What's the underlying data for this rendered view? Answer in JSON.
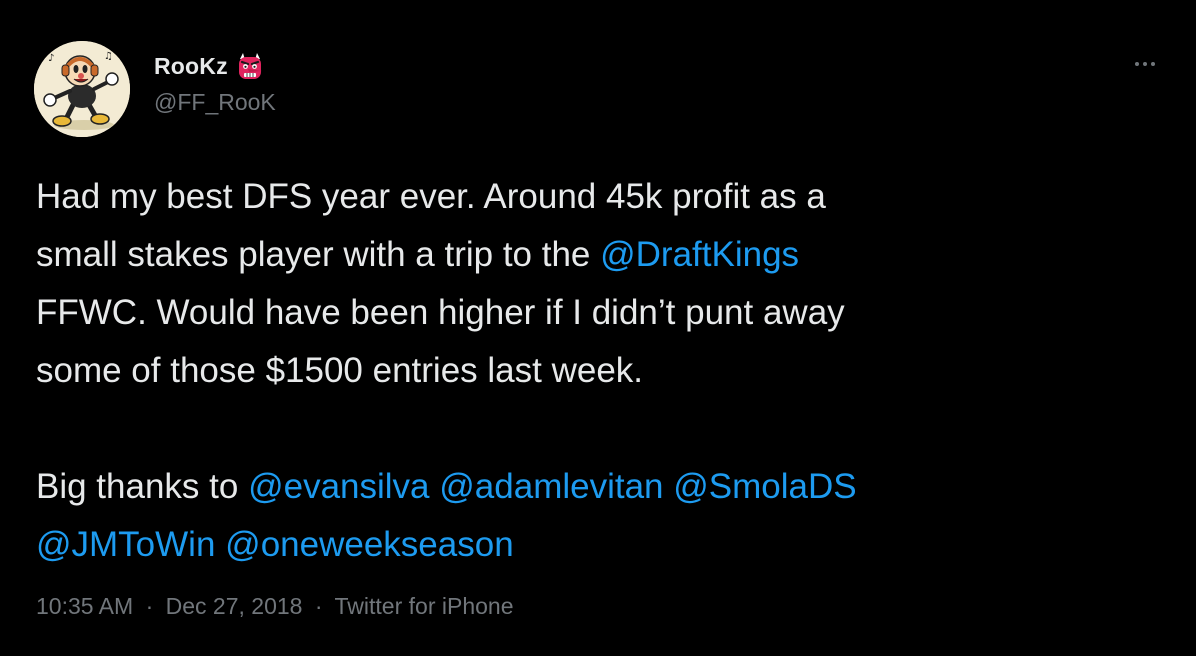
{
  "user": {
    "display_name": "RooKz",
    "name_emoji": "goblin-emoji",
    "handle": "@FF_RooK"
  },
  "menu": {
    "more_icon": "more-icon"
  },
  "tweet": {
    "lines": [
      [
        {
          "text": "Had my best DFS year ever. Around 45k profit as a",
          "mention": false
        }
      ],
      [
        {
          "text": "small stakes player with a trip to the ",
          "mention": false
        },
        {
          "text": "@DraftKings",
          "mention": true
        }
      ],
      [
        {
          "text": "FFWC. Would have been higher if I didn’t punt away",
          "mention": false
        }
      ],
      [
        {
          "text": "some of those $1500 entries last week.",
          "mention": false
        }
      ],
      [],
      [
        {
          "text": "Big thanks to ",
          "mention": false
        },
        {
          "text": "@evansilva",
          "mention": true
        },
        {
          "text": " ",
          "mention": false
        },
        {
          "text": "@adamlevitan",
          "mention": true
        },
        {
          "text": " ",
          "mention": false
        },
        {
          "text": "@SmolaDS",
          "mention": true
        }
      ],
      [
        {
          "text": "@JMToWin",
          "mention": true
        },
        {
          "text": " ",
          "mention": false
        },
        {
          "text": "@oneweekseason",
          "mention": true
        }
      ]
    ]
  },
  "meta": {
    "time": "10:35 AM",
    "separator": "·",
    "date": "Dec 27, 2018",
    "source": "Twitter for iPhone"
  },
  "colors": {
    "background": "#000000",
    "text": "#e7e9ea",
    "secondary": "#71767b",
    "mention": "#1d9bf0"
  }
}
